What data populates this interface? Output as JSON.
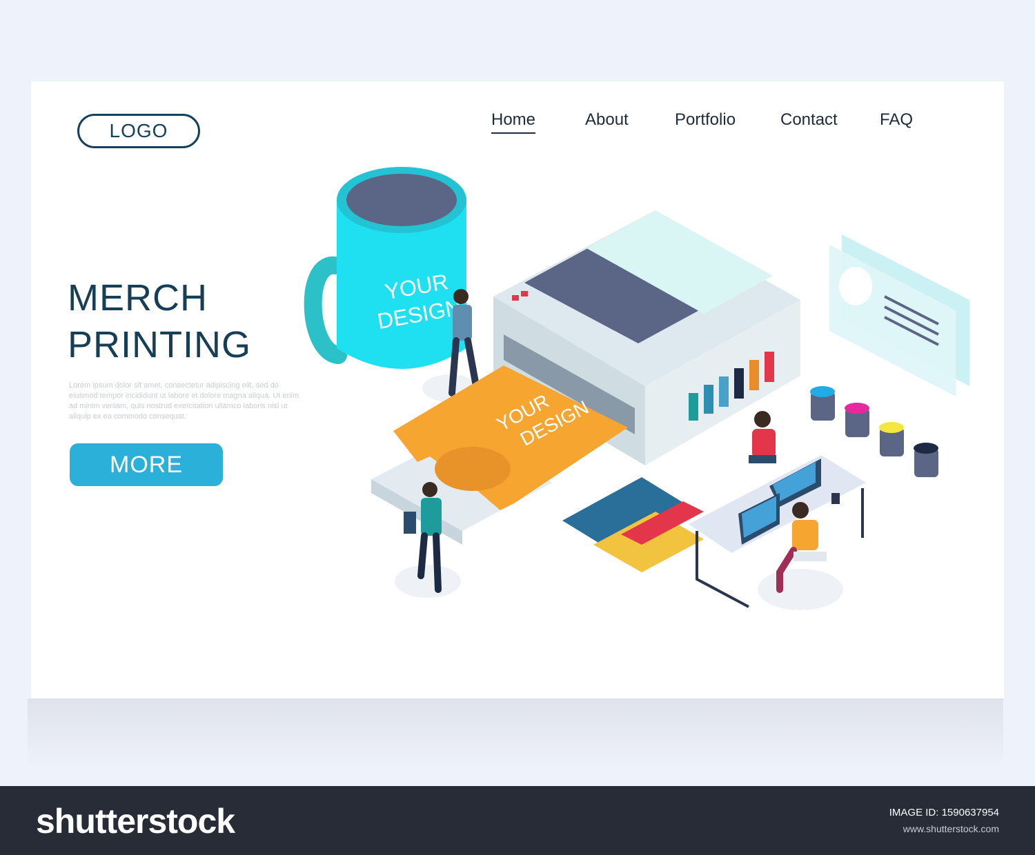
{
  "header": {
    "logo_label": "LOGO",
    "nav": [
      "Home",
      "About",
      "Portfolio",
      "Contact",
      "FAQ"
    ],
    "active_nav": "Home"
  },
  "hero": {
    "title_line1": "MERCH",
    "title_line2": "PRINTING",
    "body_text": "Lorem ipsum dolor sit amet, consectetur adipiscing elit, sed do eiusmod tempor incididunt ut labore et dolore magna aliqua. Ut enim ad minim veniam, quis nostrud exercitation ullamco laboris nisi ut aliquip ex ea commodo consequat.",
    "button_label": "MORE"
  },
  "illustration": {
    "mug_text_1": "YOUR",
    "mug_text_2": "DESIGN",
    "shirt_text_1": "YOUR",
    "shirt_text_2": "DESIGN"
  },
  "footer": {
    "brand": "shutterstock",
    "image_id_label": "IMAGE ID: 1590637954",
    "site": "www.shutterstock.com"
  },
  "colors": {
    "background": "#eef2fb",
    "accent": "#2ab0d9",
    "title": "#163e57",
    "mug": "#1ee0f0",
    "shirt": "#f6a630",
    "printer_top": "#5b6585",
    "footer": "#272c36"
  }
}
